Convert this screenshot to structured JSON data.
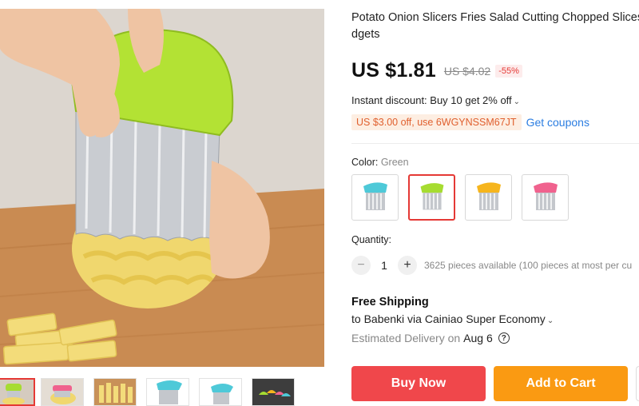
{
  "product": {
    "title_line1": "Potato Onion Slicers Fries Salad Cutting Chopped Slices",
    "title_line2": "dgets"
  },
  "price": {
    "current": "US $1.81",
    "original": "US $4.02",
    "discount": "-55%"
  },
  "promo": {
    "instant_discount": "Instant discount: Buy 10 get 2% off",
    "coupon_code": "US $3.00 off, use 6WGYNSSM67JT",
    "get_coupons": "Get coupons"
  },
  "color": {
    "label": "Color:",
    "selected": "Green",
    "options": [
      {
        "name": "Blue",
        "hex": "#4ec9d8"
      },
      {
        "name": "Green",
        "hex": "#a6dc31"
      },
      {
        "name": "Orange",
        "hex": "#f6b51d"
      },
      {
        "name": "Pink",
        "hex": "#f0628e"
      }
    ],
    "selected_index": 1
  },
  "quantity": {
    "label": "Quantity:",
    "minus": "−",
    "value": "1",
    "plus": "+",
    "available": "3625 pieces available (100 pieces at most per cu"
  },
  "shipping": {
    "title": "Free Shipping",
    "to": "to Babenki via Cainiao Super Economy",
    "delivery_label": "Estimated Delivery on",
    "delivery_date": "Aug 6",
    "help_glyph": "?"
  },
  "actions": {
    "buy_now": "Buy Now",
    "add_to_cart": "Add to Cart"
  },
  "gallery": {
    "thumb_count": 6,
    "active_thumb": 0
  },
  "theme": {
    "accent_red": "#f0474b",
    "accent_orange": "#fa9a12",
    "link_blue": "#2b7de1",
    "coupon_orange": "#e0602f"
  }
}
